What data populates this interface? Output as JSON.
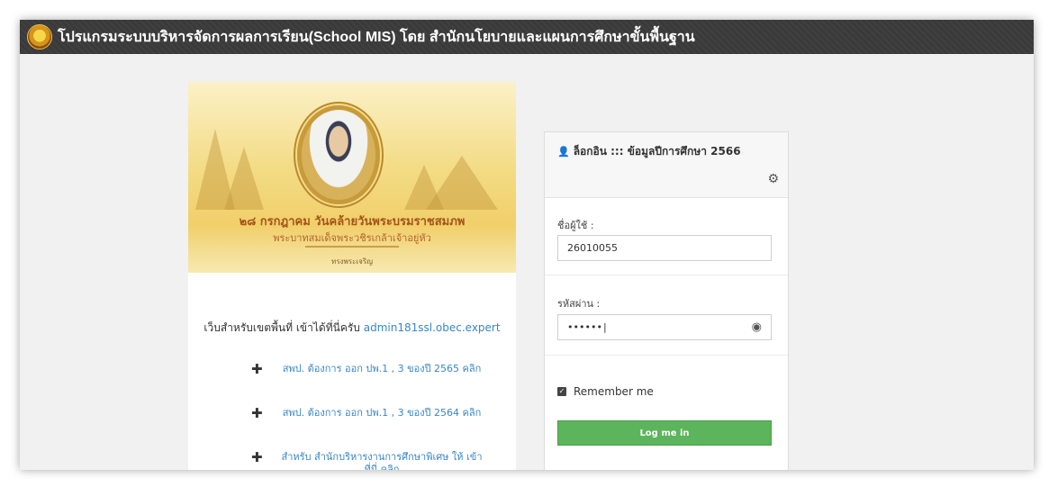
{
  "header": {
    "title": "โปรแกรมระบบบริหารจัดการผลการเรียน(School MIS) โดย สำนักนโยบายและแผนการศึกษาขั้นพื้นฐาน",
    "logo_icon": "school-emblem-icon"
  },
  "banner": {
    "line1": "๒๘ กรกฎาคม วันคล้ายวันพระบรมราชสมภพ",
    "line2": "พระบาทสมเด็จพระวชิรเกล้าเจ้าอยู่หัว",
    "line3": "ทรงพระเจริญ"
  },
  "left": {
    "intro_text": "เว็บสำหรับเขตพื้นที่ เข้าได้ที่นี่ครับ",
    "intro_link": "admin181ssl.obec.expert",
    "links": [
      {
        "icon": "plus-icon",
        "text": "สพป. ต้องการ ออก ปพ.1 , 3  ของปี 2565 คลิก"
      },
      {
        "icon": "plus-icon",
        "text": "สพป. ต้องการ ออก ปพ.1 , 3  ของปี 2564 คลิก"
      },
      {
        "icon": "plus-icon",
        "text": "สำหรับ สำนักบริหารงานการศึกษาพิเศษ ให้ เข้าที่นี่ คลิก"
      }
    ]
  },
  "login": {
    "title": "ล็อกอิน ::: ข้อมูลปีการศึกษา 2566",
    "user_icon": "user-icon",
    "settings_icon": "gear-icon",
    "username_label": "ชื่อผู้ใช้ :",
    "username_value": "26010055",
    "password_label": "รหัสผ่าน :",
    "password_value": "••••••",
    "show_password_icon": "eye-icon",
    "remember_label": "Remember me",
    "remember_checked": true,
    "submit_label": "Log me in",
    "submit_color": "#5cb45c"
  }
}
